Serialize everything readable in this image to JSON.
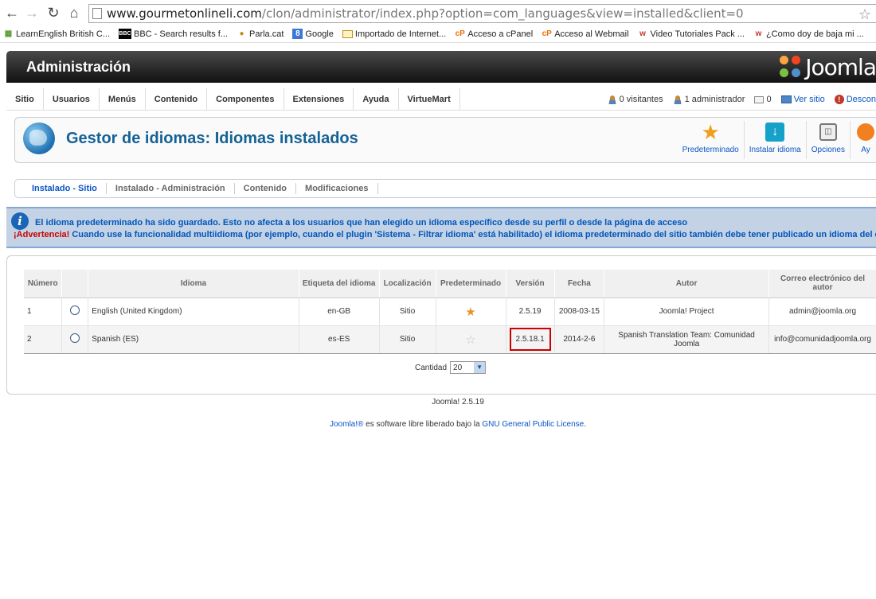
{
  "browser": {
    "url_host": "www.gourmetonlineli.com",
    "url_path": "/clon/administrator/index.php?option=com_languages&view=installed&client=0",
    "bookmarks": [
      {
        "label": "LearnEnglish British C...",
        "icon": "grid-icon"
      },
      {
        "label": "BBC - Search results f...",
        "icon": "bbc-icon"
      },
      {
        "label": "Parla.cat",
        "icon": "parla-icon"
      },
      {
        "label": "Google",
        "icon": "google-icon"
      },
      {
        "label": "Importado de Internet...",
        "icon": "folder-icon"
      },
      {
        "label": "Acceso a cPanel",
        "icon": "cpanel-icon"
      },
      {
        "label": "Acceso al Webmail",
        "icon": "cpanel-icon"
      },
      {
        "label": "Video Tutoriales Pack ...",
        "icon": "w-icon"
      },
      {
        "label": "¿Como doy de baja mi ...",
        "icon": "w-icon"
      }
    ]
  },
  "header": {
    "title": "Administración",
    "logo_text": "Joomla"
  },
  "menu": {
    "items": [
      "Sitio",
      "Usuarios",
      "Menús",
      "Contenido",
      "Componentes",
      "Extensiones",
      "Ayuda",
      "VirtueMart"
    ],
    "status": {
      "visitors": "0 visitantes",
      "admins": "1 administrador",
      "messages": "0",
      "view_site": "Ver sitio",
      "logout": "Descon"
    }
  },
  "toolbar": {
    "title": "Gestor de idiomas: Idiomas instalados",
    "buttons": [
      {
        "label": "Predeterminado",
        "icon": "star-icon"
      },
      {
        "label": "Instalar idioma",
        "icon": "install-icon"
      },
      {
        "label": "Opciones",
        "icon": "options-icon"
      },
      {
        "label": "Ay",
        "icon": "help-icon"
      }
    ]
  },
  "submenu": {
    "tabs": [
      "Instalado - Sitio",
      "Instalado - Administración",
      "Contenido",
      "Modificaciones"
    ],
    "active": 0
  },
  "message": {
    "line1": "El idioma predeterminado ha sido guardado. Esto no afecta a los usuarios que han elegido un idioma específico desde su perfil o desde la página de acceso",
    "warning_label": "¡Advertencia!",
    "line2": " Cuando use la funcionalidad multiidioma (por ejemplo, cuando el plugin 'Sistema - Filtrar idioma' está habilitado) el idioma predeterminado del sitio también debe tener publicado un idioma del contenido."
  },
  "table": {
    "headers": [
      "Número",
      "",
      "Idioma",
      "Etiqueta del idioma",
      "Localización",
      "Predeterminado",
      "Versión",
      "Fecha",
      "Autor",
      "Correo electrónico del autor"
    ],
    "rows": [
      {
        "num": "1",
        "language": "English (United Kingdom)",
        "tag": "en-GB",
        "location": "Sitio",
        "default": true,
        "version": "2.5.19",
        "date": "2008-03-15",
        "author": "Joomla! Project",
        "email": "admin@joomla.org"
      },
      {
        "num": "2",
        "language": "Spanish (ES)",
        "tag": "es-ES",
        "location": "Sitio",
        "default": false,
        "version": "2.5.18.1",
        "date": "2014-2-6",
        "author": "Spanish Translation Team: Comunidad Joomla",
        "email": "info@comunidadjoomla.org"
      }
    ],
    "pager_label": "Cantidad",
    "pager_value": "20"
  },
  "footer": {
    "version": "Joomla! 2.5.19",
    "license_prefix": "Joomla!®",
    "license_middle": " es software libre liberado bajo la ",
    "license_link": "GNU General Public License",
    "license_suffix": "."
  }
}
